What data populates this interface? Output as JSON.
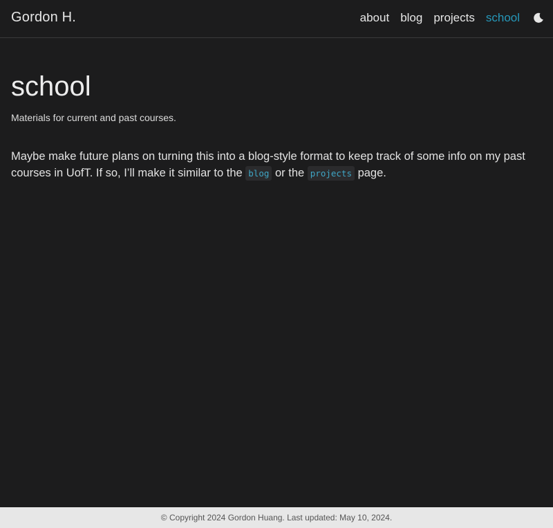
{
  "header": {
    "brand": "Gordon H.",
    "nav": [
      {
        "label": "about"
      },
      {
        "label": "blog"
      },
      {
        "label": "projects"
      },
      {
        "label": "school"
      }
    ],
    "active_item": "school",
    "theme_toggle_icon": "moon-icon",
    "accent_color": "#2698ba"
  },
  "page": {
    "title": "school",
    "description": "Materials for current and past courses.",
    "paragraph": {
      "part1": "Maybe make future plans on turning this into a blog-style format to keep track of some info on my past courses in UofT. If so, I’ll make it similar to the ",
      "code1": "blog",
      "part2": " or the ",
      "code2": "projects",
      "part3": " page."
    }
  },
  "footer": {
    "text": "© Copyright 2024 Gordon Huang. Last updated: May 10, 2024."
  }
}
